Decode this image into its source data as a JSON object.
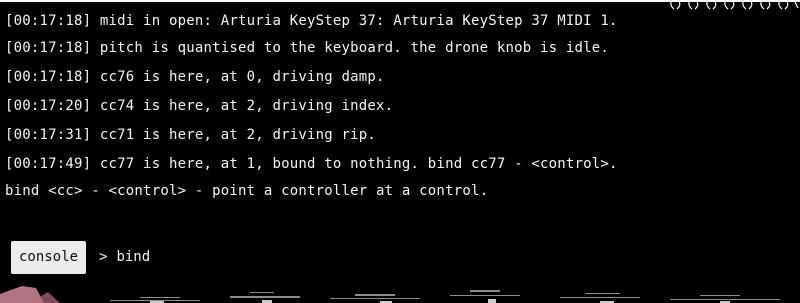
{
  "log": [
    "[00:17:18] midi in open: Arturia KeyStep 37: Arturia KeyStep 37 MIDI 1.",
    "[00:17:18] pitch is quantised to the keyboard. the drone knob is idle.",
    "[00:17:18] cc76 is here, at 0, driving damp.",
    "[00:17:20] cc74 is here, at 2, driving index.",
    "[00:17:31] cc71 is here, at 2, driving rip.",
    "[00:17:49] cc77 is here, at 1, bound to nothing. bind cc77 - <control>.",
    "bind <cc> - <control> - point a controller at a control."
  ],
  "console": {
    "tab_label": "console",
    "prompt_symbol": ">",
    "input_value": "bind"
  },
  "colors": {
    "background": "#000000",
    "text": "#f2f2f2",
    "tab_background": "#ececec",
    "tab_text": "#111111",
    "glitch_pink": "#d0899a"
  }
}
